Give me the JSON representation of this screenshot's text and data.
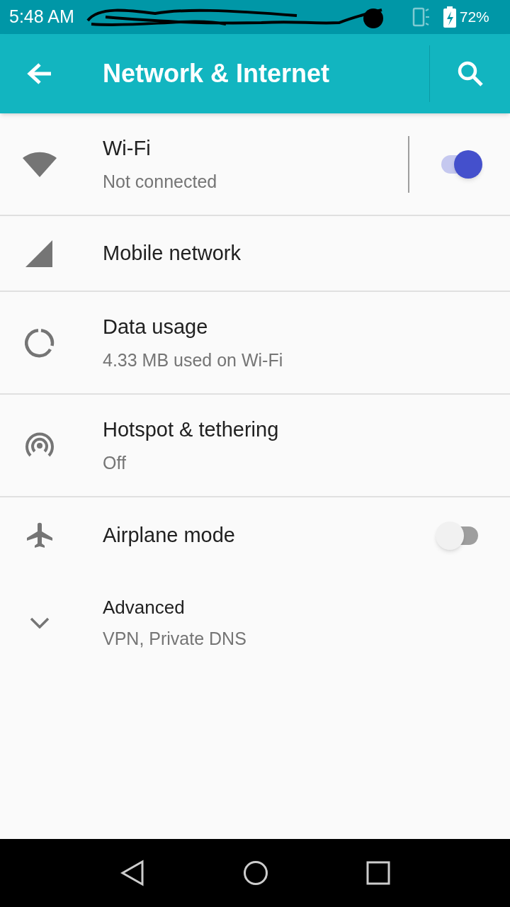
{
  "status_bar": {
    "time": "5:48 AM",
    "battery": "72%"
  },
  "toolbar": {
    "title": "Network & Internet"
  },
  "items": [
    {
      "kind": "toggle",
      "title": "Wi-Fi",
      "subtitle": "Not connected",
      "on": true,
      "divider": true
    },
    {
      "kind": "plain",
      "title": "Mobile network"
    },
    {
      "kind": "plain",
      "title": "Data usage",
      "subtitle": "4.33 MB used on Wi-Fi"
    },
    {
      "kind": "plain",
      "title": "Hotspot & tethering",
      "subtitle": "Off"
    },
    {
      "kind": "toggle",
      "title": "Airplane mode",
      "on": false,
      "divider": false
    },
    {
      "kind": "expand",
      "title": "Advanced",
      "subtitle": "VPN, Private DNS"
    }
  ]
}
